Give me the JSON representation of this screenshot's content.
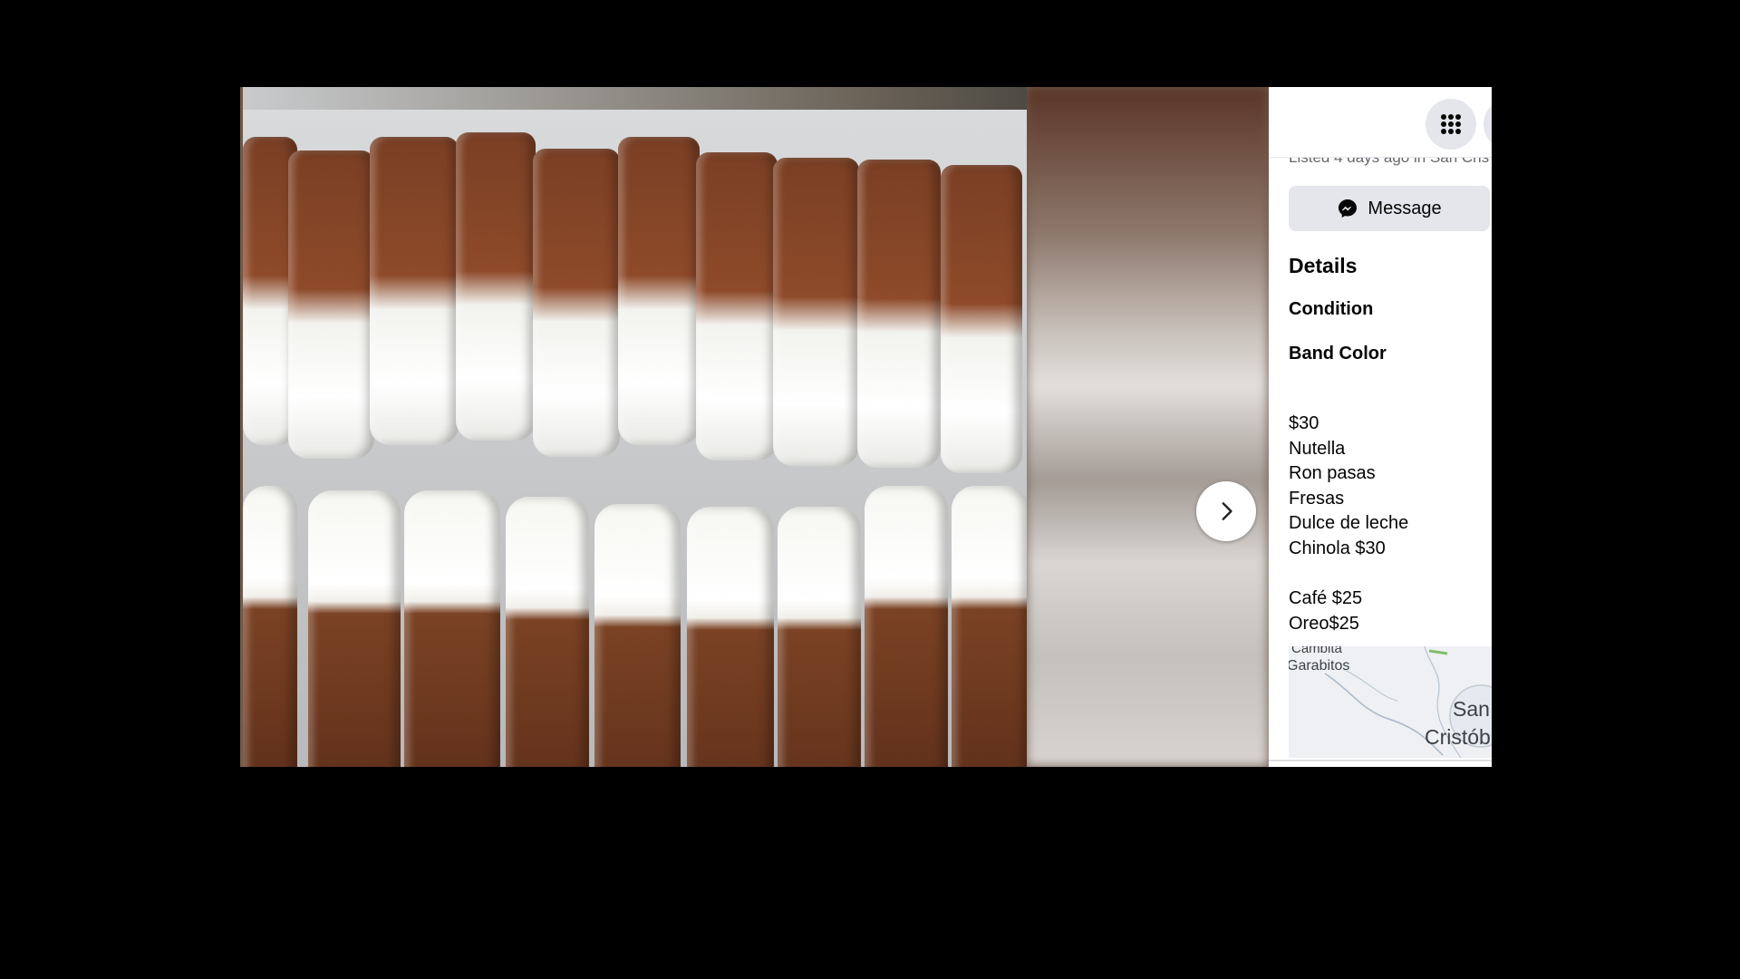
{
  "listing": {
    "listed_text": "Listed 4 days ago in San Cris",
    "message_label": "Message",
    "details_heading": "Details",
    "condition_label": "Condition",
    "band_color_label": "Band Color",
    "description_lines": [
      "$30",
      "Nutella",
      "Ron pasas",
      "Fresas",
      "Dulce de leche",
      "Chinola $30",
      "",
      "Café $25",
      "Oreo$25"
    ]
  },
  "map": {
    "label_1": "Cambita",
    "label_2": "Garabitos",
    "label_3": "San",
    "label_4": "Cristób"
  },
  "icons": {
    "menu": "grid-menu-icon",
    "message": "messenger-icon",
    "next": "chevron-right-icon"
  },
  "colors": {
    "backdrop": "#000000",
    "panel_bg": "#ffffff",
    "button_bg": "#e4e6eb",
    "text_primary": "#050505",
    "text_secondary": "#65676b"
  }
}
